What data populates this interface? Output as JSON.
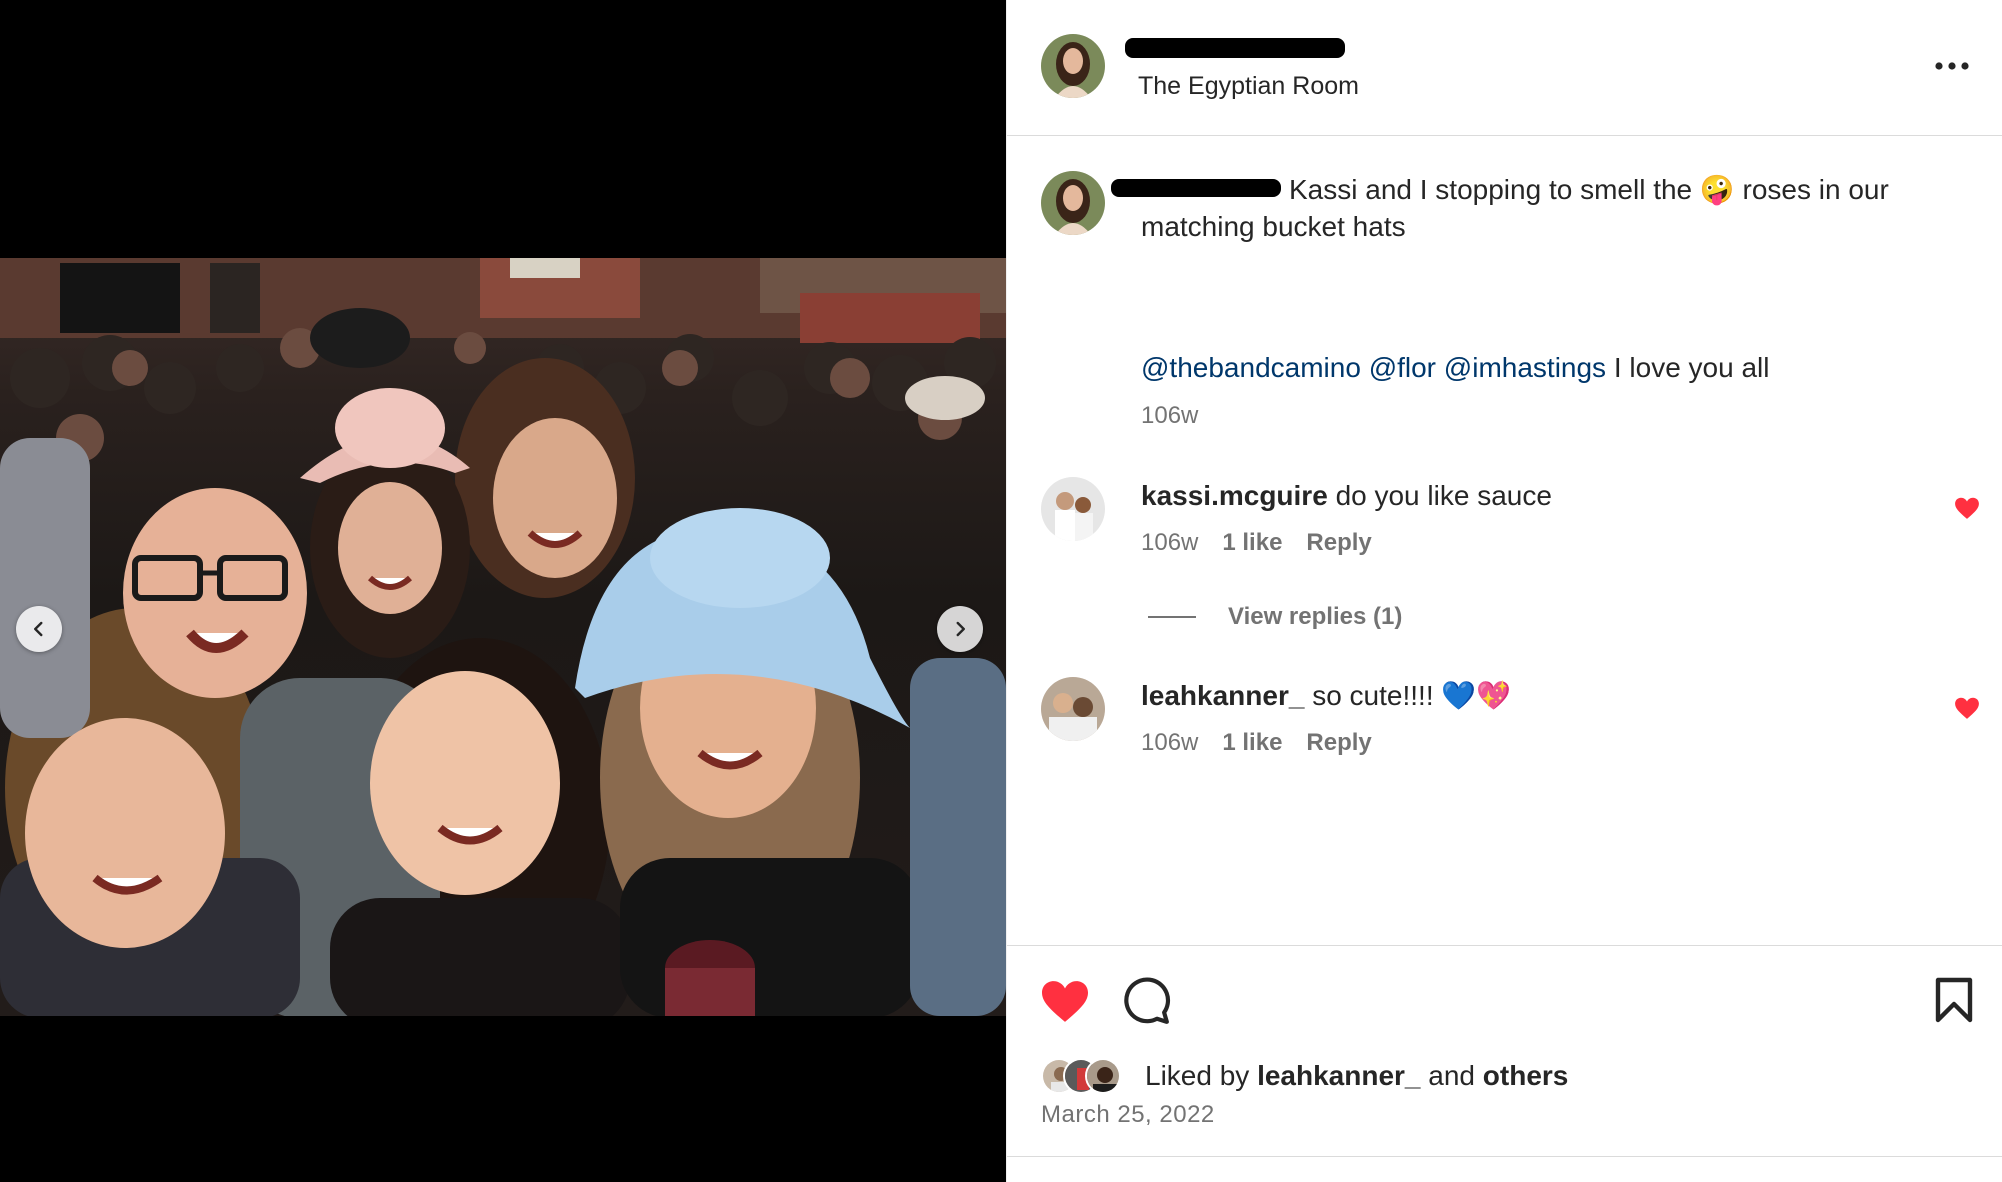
{
  "post": {
    "location": "The Egyptian Room",
    "caption_text": "Kassi and I stopping to smell the 🤪 roses in our matching bucket hats",
    "caption_mentions": [
      "@thebandcamino",
      "@flor",
      "@imhastings"
    ],
    "caption_tail": "I love you all",
    "caption_time": "106w"
  },
  "comments": [
    {
      "username": "kassi.mcguire",
      "text": "do you like sauce",
      "time": "106w",
      "likes": "1 like",
      "reply_label": "Reply",
      "view_replies": "View replies (1)"
    },
    {
      "username": "leahkanner_",
      "text": "so cute!!!! 💙💖",
      "time": "106w",
      "likes": "1 like",
      "reply_label": "Reply"
    }
  ],
  "likes": {
    "prefix": "Liked by",
    "user": "leahkanner_",
    "middle": "and",
    "suffix": "others"
  },
  "date": "March 25, 2022",
  "colors": {
    "like_red": "#ff3040",
    "mention_blue": "#00376b",
    "muted": "#737373"
  },
  "icons": [
    "more-icon",
    "chevron-left-icon",
    "chevron-right-icon",
    "heart-icon",
    "comment-icon",
    "bookmark-icon"
  ]
}
